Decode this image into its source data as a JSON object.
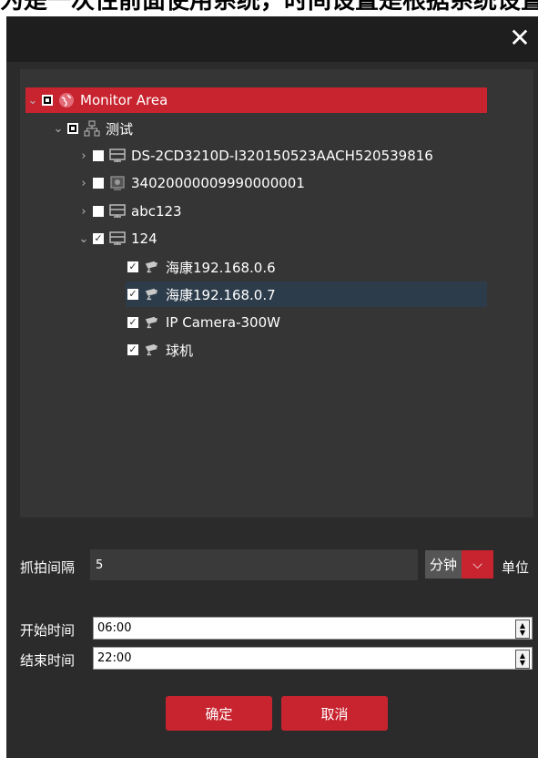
{
  "top_fragment": "为是一次性前面使用系统，时间设置是根据系统设置，设",
  "dialog": {
    "close_label": "✕"
  },
  "tree": {
    "root": {
      "label": "Monitor Area"
    },
    "group": {
      "label": "测试"
    },
    "devices": [
      {
        "label": "DS-2CD3210D-I320150523AACH520539816"
      },
      {
        "label": "34020000009990000001"
      },
      {
        "label": "abc123"
      },
      {
        "label": "124"
      }
    ],
    "cameras": [
      {
        "label": "海康192.168.0.6"
      },
      {
        "label": "海康192.168.0.7"
      },
      {
        "label": "IP Camera-300W"
      },
      {
        "label": "球机"
      }
    ]
  },
  "form": {
    "interval_label": "抓拍间隔",
    "interval_value": "5",
    "unit_value": "分钟",
    "unit_suffix": "单位",
    "start_label": "开始时间",
    "start_value": "06:00",
    "end_label": "结束时间",
    "end_value": "22:00"
  },
  "buttons": {
    "confirm": "确定",
    "cancel": "取消"
  },
  "colors": {
    "accent": "#c8242f",
    "dialog_bg": "#2b2b2b",
    "panel_bg": "#353535",
    "selected_row": "#2d3c4b"
  }
}
